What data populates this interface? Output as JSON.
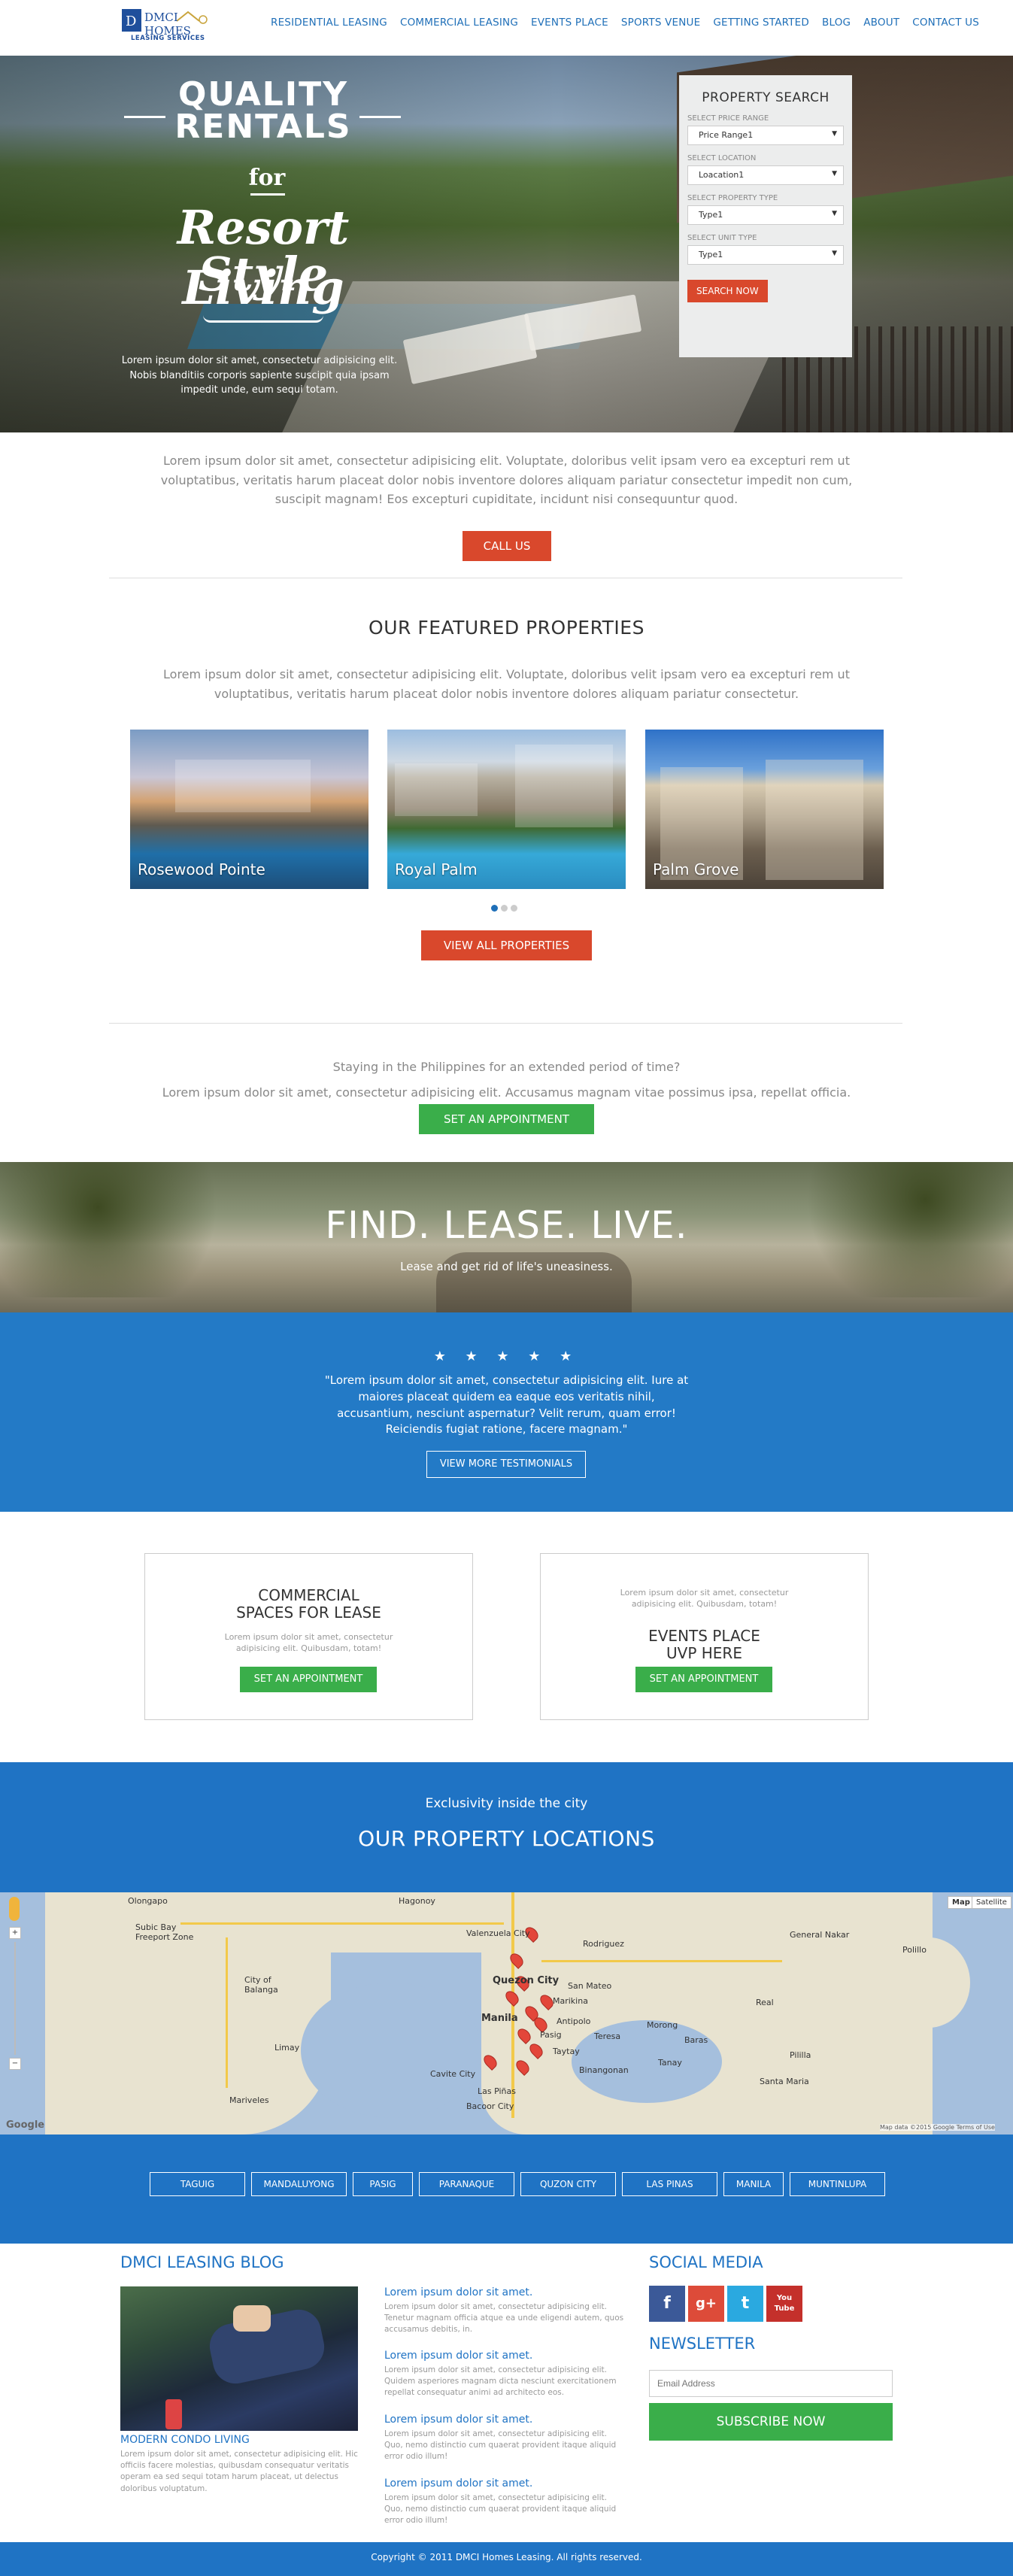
{
  "header": {
    "logo_name": "DMCI HOMES",
    "logo_sub": "LEASING SERVICES",
    "nav": [
      "RESIDENTIAL LEASING",
      "COMMERCIAL LEASING",
      "EVENTS PLACE",
      "SPORTS VENUE",
      "GETTING STARTED",
      "BLOG",
      "ABOUT",
      "CONTACT US"
    ]
  },
  "hero": {
    "line1": "QUALITY",
    "line2": "RENTALS",
    "line3": "for",
    "line4": "Resort Style",
    "line5": "Living",
    "copy": "Lorem ipsum dolor sit amet, consectetur adipisicing elit. Nobis blanditiis corporis sapiente suscipit quia ipsam impedit unde, eum sequi totam."
  },
  "search": {
    "title": "PROPERTY SEARCH",
    "fields": [
      {
        "label": "SELECT PRICE RANGE",
        "value": "Price Range1"
      },
      {
        "label": "SELECT LOCATION",
        "value": "Loacation1"
      },
      {
        "label": "SELECT PROPERTY TYPE",
        "value": "Type1"
      },
      {
        "label": "SELECT UNIT TYPE",
        "value": "Type1"
      }
    ],
    "button": "SEARCH NOW"
  },
  "intro": {
    "text": "Lorem ipsum dolor sit amet, consectetur adipisicing elit. Voluptate, doloribus velit ipsam vero ea excepturi rem ut voluptatibus, veritatis harum placeat dolor nobis inventore dolores aliquam pariatur consectetur impedit non cum, suscipit magnam! Eos excepturi cupiditate, incidunt nisi consequuntur quod.",
    "button": "CALL US"
  },
  "featured": {
    "title": "OUR FEATURED PROPERTIES",
    "text": "Lorem ipsum dolor sit amet, consectetur adipisicing elit. Voluptate, doloribus velit ipsam vero ea excepturi rem ut voluptatibus, veritatis harum placeat dolor nobis inventore dolores aliquam pariatur consectetur.",
    "properties": [
      "Rosewood Pointe",
      "Royal Palm",
      "Palm Grove"
    ],
    "button": "VIEW ALL PROPERTIES"
  },
  "appointment": {
    "line1": "Staying in the Philippines for an extended period of time?",
    "line2": "Lorem ipsum dolor sit amet, consectetur adipisicing elit. Accusamus magnam vitae possimus ipsa, repellat officia.",
    "button": "SET AN APPOINTMENT"
  },
  "banner": {
    "title": "FIND. LEASE. LIVE.",
    "sub": "Lease and get rid of life's uneasiness."
  },
  "testimonial": {
    "stars": "★ ★ ★ ★ ★",
    "quote": "\"Lorem ipsum dolor sit amet, consectetur adipisicing elit. Iure at maiores placeat quidem ea eaque eos veritatis nihil, accusantium, nesciunt aspernatur? Velit rerum, quam error! Reiciendis fugiat ratione, facere magnam.\"",
    "button": "VIEW MORE TESTIMONIALS"
  },
  "boxes": [
    {
      "title1": "COMMERCIAL",
      "title2": "SPACES FOR LEASE",
      "text": "Lorem ipsum dolor sit amet, consectetur adipisicing elit. Quibusdam, totam!",
      "button": "SET AN APPOINTMENT"
    },
    {
      "title1": "EVENTS PLACE",
      "title2": "UVP HERE",
      "text": "Lorem ipsum dolor sit amet, consectetur adipisicing elit. Quibusdam, totam!",
      "button": "SET AN APPOINTMENT"
    }
  ],
  "locations": {
    "sub": "Exclusivity inside the city",
    "title": "OUR PROPERTY LOCATIONS",
    "map": {
      "map_btn": "Map",
      "sat_btn": "Satellite",
      "google": "Google",
      "terms": "Map data ©2015 Google   Terms of Use",
      "labels": [
        "Olongapo",
        "Subic Bay Freeport Zone",
        "Hagonoy",
        "Valenzuela City",
        "Quezon City",
        "San Mateo",
        "Rodriguez",
        "Marikina",
        "Manila",
        "Antipolo",
        "Pasig",
        "Teresa",
        "Taytay",
        "Cavite City",
        "Las Piñas",
        "Bacoor City",
        "City of Balanga",
        "Limay",
        "Mariveles",
        "Binangonan",
        "Tanay",
        "Santa Maria",
        "Pililla",
        "Polillo",
        "Real",
        "General Nakar",
        "Morong",
        "Baras"
      ]
    },
    "cities": [
      "TAGUIG",
      "MANDALUYONG",
      "PASIG",
      "PARANAQUE",
      "QUZON CITY",
      "LAS PINAS",
      "MANILA",
      "MUNTINLUPA"
    ]
  },
  "blog": {
    "title": "DMCI LEASING BLOG",
    "featured_caption": "MODERN CONDO LIVING",
    "featured_text": "Lorem ipsum dolor sit amet, consectetur adipisicing elit. Hic officiis facere molestias, quibusdam consequatur veritatis operam ea sed sequi totam harum placeat, ut delectus doloribus voluptatum.",
    "posts": [
      {
        "title": "Lorem ipsum dolor sit amet.",
        "text": "Lorem ipsum dolor sit amet, consectetur adipisicing elit. Tenetur magnam officia atque ea unde eligendi autem, quos accusamus debitis, in."
      },
      {
        "title": "Lorem ipsum dolor sit amet.",
        "text": "Lorem ipsum dolor sit amet, consectetur adipisicing elit. Quidem asperiores magnam dicta nesciunt exercitationem repellat consequatur animi ad architecto eos."
      },
      {
        "title": "Lorem ipsum dolor sit amet.",
        "text": "Lorem ipsum dolor sit amet, consectetur adipisicing elit. Quo, nemo distinctio cum quaerat provident itaque aliquid error odio illum!"
      },
      {
        "title": "Lorem ipsum dolor sit amet.",
        "text": "Lorem ipsum dolor sit amet, consectetur adipisicing elit. Quo, nemo distinctio cum quaerat provident itaque aliquid error odio illum!"
      }
    ]
  },
  "social": {
    "title": "SOCIAL MEDIA",
    "icons": [
      {
        "name": "facebook-icon",
        "glyph": "f",
        "color": "#3b5998"
      },
      {
        "name": "google-plus-icon",
        "glyph": "g+",
        "color": "#dd4b39"
      },
      {
        "name": "twitter-icon",
        "glyph": "t",
        "color": "#2aa9e0"
      },
      {
        "name": "youtube-icon",
        "glyph": "You Tube",
        "color": "#c4302b"
      }
    ]
  },
  "newsletter": {
    "title": "NEWSLETTER",
    "placeholder": "Email Address",
    "button": "SUBSCRIBE NOW"
  },
  "footer": {
    "copyright": "Copyright © 2011 DMCI Homes Leasing. All rights reserved."
  },
  "colors": {
    "brand_blue": "#1f73c4",
    "accent_red": "#d9482c",
    "cta_green": "#3aae4a"
  }
}
